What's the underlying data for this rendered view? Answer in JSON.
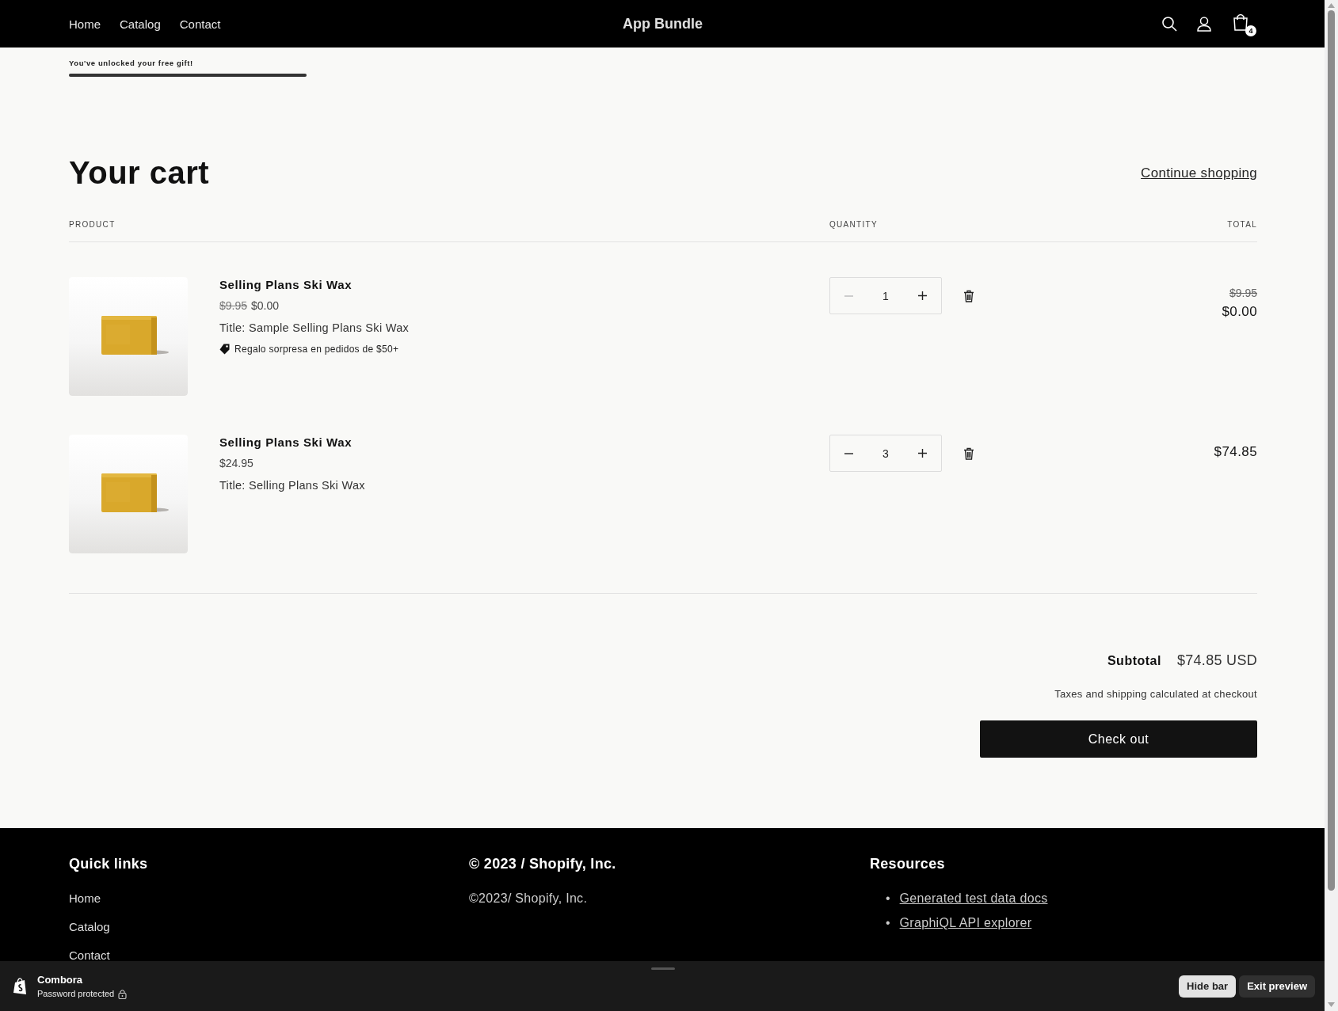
{
  "header": {
    "nav": [
      {
        "label": "Home"
      },
      {
        "label": "Catalog"
      },
      {
        "label": "Contact"
      }
    ],
    "title": "App Bundle",
    "cart_count": "4"
  },
  "gift_progress": {
    "message": "You've unlocked your free gift!",
    "level": 1
  },
  "cart": {
    "title": "Your cart",
    "continue_link": "Continue shopping",
    "columns": [
      "PRODUCT",
      "QUANTITY",
      "TOTAL"
    ],
    "items": [
      {
        "name": "Selling Plans Ski Wax",
        "compare_price": "$9.95",
        "price": "$0.00",
        "option": "Title: Sample Selling Plans Ski Wax",
        "discount": "Regalo sorpresa en pedidos de $50+",
        "quantity": "1",
        "decrease_disabled": true,
        "total_compare": "$9.95",
        "total": "$0.00"
      },
      {
        "name": "Selling Plans Ski Wax",
        "price": "$24.95",
        "option": "Title: Selling Plans Ski Wax",
        "quantity": "3",
        "decrease_disabled": false,
        "total": "$74.85"
      }
    ],
    "subtotal_label": "Subtotal",
    "subtotal": "$74.85 USD",
    "tax_note": "Taxes and shipping calculated at checkout",
    "checkout": "Check out"
  },
  "footer": {
    "columns": [
      {
        "kind": "links",
        "heading": "Quick links",
        "items": [
          "Home",
          "Catalog",
          "Contact"
        ]
      },
      {
        "kind": "text",
        "heading": "© 2023 / Shopify, Inc.",
        "text": "©2023/ Shopify, Inc."
      },
      {
        "kind": "bullets",
        "heading": "Resources",
        "marker": "•",
        "items": [
          "Generated test data docs",
          "GraphiQL API explorer"
        ]
      }
    ]
  },
  "preview_bar": {
    "store": "Combora",
    "status": "Password protected",
    "buttons": [
      {
        "label": "Hide bar",
        "kind": "light"
      },
      {
        "label": "Exit preview",
        "kind": "dark"
      }
    ]
  }
}
